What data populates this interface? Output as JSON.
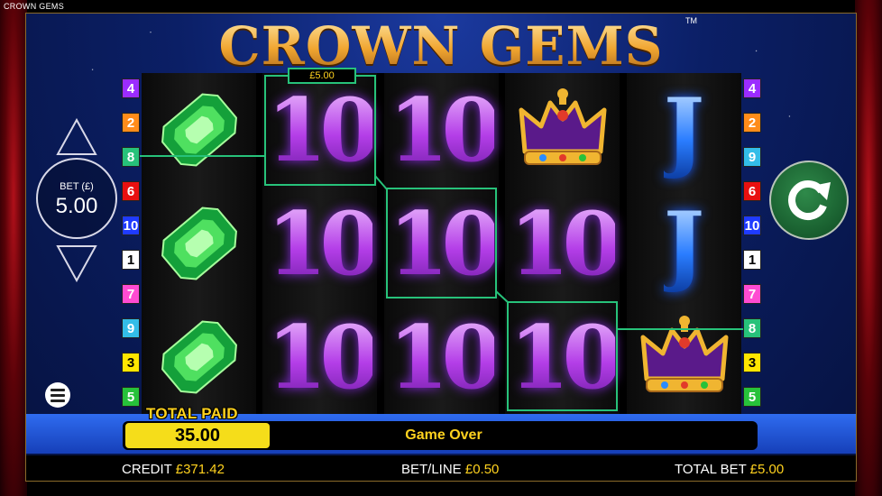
{
  "game": {
    "top_left_title": "CROWN GEMS",
    "logo_text": "CROWN GEMS",
    "trademark": "TM"
  },
  "bet_panel": {
    "label": "BET (£)",
    "value": "5.00"
  },
  "paylines_left": [
    "4",
    "2",
    "8",
    "6",
    "10",
    "1",
    "7",
    "9",
    "3",
    "5"
  ],
  "paylines_right": [
    "4",
    "2",
    "9",
    "6",
    "10",
    "1",
    "7",
    "8",
    "3",
    "5"
  ],
  "payline_colors": {
    "1": "#ffffff",
    "2": "#ff8c1a",
    "3": "#ffe600",
    "4": "#9b2cff",
    "5": "#27c23a",
    "6": "#e81010",
    "7": "#ff4bd2",
    "8": "#27c27a",
    "9": "#33bde8",
    "10": "#1f3bff"
  },
  "reels": [
    [
      "emerald",
      "emerald",
      "emerald"
    ],
    [
      "10",
      "10",
      "10"
    ],
    [
      "10",
      "10",
      "10"
    ],
    [
      "crown",
      "10",
      "10"
    ],
    [
      "J",
      "J",
      "crown"
    ]
  ],
  "win": {
    "line_win_label": "£5.00",
    "line_color": "#27c27a"
  },
  "total_paid": {
    "label": "TOTAL PAID",
    "value": "35.00"
  },
  "status_message": "Game Over",
  "footer": {
    "credit_label": "CREDIT",
    "credit_value": "£371.42",
    "bet_line_label": "BET/LINE",
    "bet_line_value": "£0.50",
    "total_bet_label": "TOTAL BET",
    "total_bet_value": "£5.00"
  },
  "icons": {
    "spin": "refresh-arrow-icon",
    "menu": "hamburger-menu-icon",
    "bet_up": "triangle-up-icon",
    "bet_down": "triangle-down-icon"
  }
}
